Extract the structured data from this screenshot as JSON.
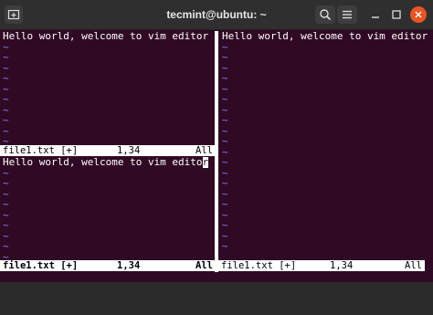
{
  "window": {
    "title": "tecmint@ubuntu: ~"
  },
  "titlebar": {
    "icons": [
      "new-tab-icon",
      "search-icon",
      "hamburger-menu-icon",
      "minimize-icon",
      "maximize-icon",
      "close-icon"
    ]
  },
  "editor": {
    "content": "Hello world, welcome to vim editor",
    "content_before_cursor": "Hello world, welcome to vim edito",
    "cursor_char": "r",
    "tilde": "~"
  },
  "status_lines": {
    "top_left": {
      "file": "file1.txt [+]",
      "position": "1,34",
      "scroll": "All"
    },
    "bottom_left": {
      "file": "file1.txt [+]",
      "position": "1,34",
      "scroll": "All"
    },
    "right": {
      "file": "file1.txt [+]",
      "position": "1,34",
      "scroll": "All"
    }
  },
  "colors": {
    "terminal_bg": "#300a24",
    "titlebar_bg": "#2f2f2f",
    "tilde": "#7f7fff",
    "close_button": "#e95420"
  }
}
